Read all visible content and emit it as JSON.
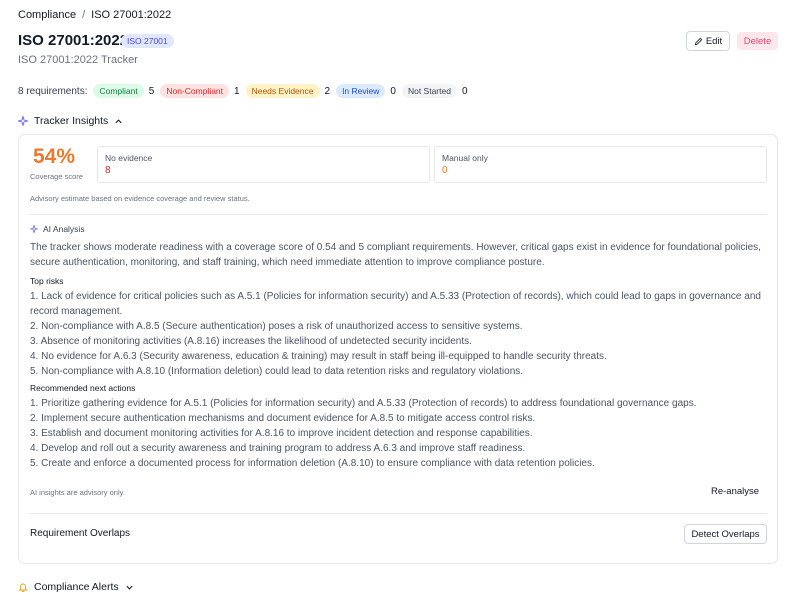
{
  "breadcrumb": {
    "items": [
      "Compliance",
      "ISO 27001:2022"
    ],
    "separator": "/"
  },
  "page": {
    "title": "ISO 27001:2022",
    "standard_badge": "ISO 27001",
    "subtitle": "ISO 27001:2022 Tracker",
    "edit_label": "Edit",
    "delete_label": "Delete"
  },
  "requirements": {
    "summary_label": "8 requirements:",
    "statuses": [
      {
        "label": "Compliant",
        "count": "5"
      },
      {
        "label": "Non-Compliant",
        "count": "1"
      },
      {
        "label": "Needs Evidence",
        "count": "2"
      },
      {
        "label": "In Review",
        "count": "0"
      },
      {
        "label": "Not Started",
        "count": "0"
      }
    ]
  },
  "insights": {
    "title": "Tracker Insights",
    "coverage_score": "54%",
    "coverage_label": "Coverage score",
    "metrics": [
      {
        "label": "No evidence",
        "value": "8"
      },
      {
        "label": "Manual only",
        "value": "0"
      }
    ],
    "advisory": "Advisory estimate based on evidence coverage and review status.",
    "ai_title": "AI Analysis",
    "ai_summary": "The tracker shows moderate readiness with a coverage score of 0.54 and 5 compliant requirements. However, critical gaps exist in evidence for foundational policies, secure authentication, monitoring, and staff training, which need immediate attention to improve compliance posture.",
    "top_risks_title": "Top risks",
    "top_risks": [
      "1. Lack of evidence for critical policies such as A.5.1 (Policies for information security) and A.5.33 (Protection of records), which could lead to gaps in governance and record management.",
      "2. Non-compliance with A.8.5 (Secure authentication) poses a risk of unauthorized access to sensitive systems.",
      "3. Absence of monitoring activities (A.8.16) increases the likelihood of undetected security incidents.",
      "4. No evidence for A.6.3 (Security awareness, education & training) may result in staff being ill-equipped to handle security threats.",
      "5. Non-compliance with A.8.10 (Information deletion) could lead to data retention risks and regulatory violations."
    ],
    "next_actions_title": "Recommended next actions",
    "next_actions": [
      "1. Prioritize gathering evidence for A.5.1 (Policies for information security) and A.5.33 (Protection of records) to address foundational governance gaps.",
      "2. Implement secure authentication mechanisms and document evidence for A.8.5 to mitigate access control risks.",
      "3. Establish and document monitoring activities for A.8.16 to improve incident detection and response capabilities.",
      "4. Develop and roll out a security awareness and training program to address A.6.3 and improve staff readiness.",
      "5. Create and enforce a documented process for information deletion (A.8.10) to ensure compliance with data retention policies."
    ],
    "ai_note": "AI insights are advisory only.",
    "reanalyse_label": "Re-analyse",
    "overlaps_title": "Requirement Overlaps",
    "detect_label": "Detect Overlaps"
  },
  "alerts": {
    "title": "Compliance Alerts"
  },
  "colors": {
    "accent": "#6366f1",
    "score": "#ea7a2e",
    "no_evidence": "#dc2626",
    "manual_only": "#ea7a2e",
    "alert_icon": "#f59e0b"
  },
  "icons": [
    "pencil-icon",
    "sparkle-icon",
    "chevron-up-icon",
    "chevron-down-icon",
    "bell-icon"
  ]
}
